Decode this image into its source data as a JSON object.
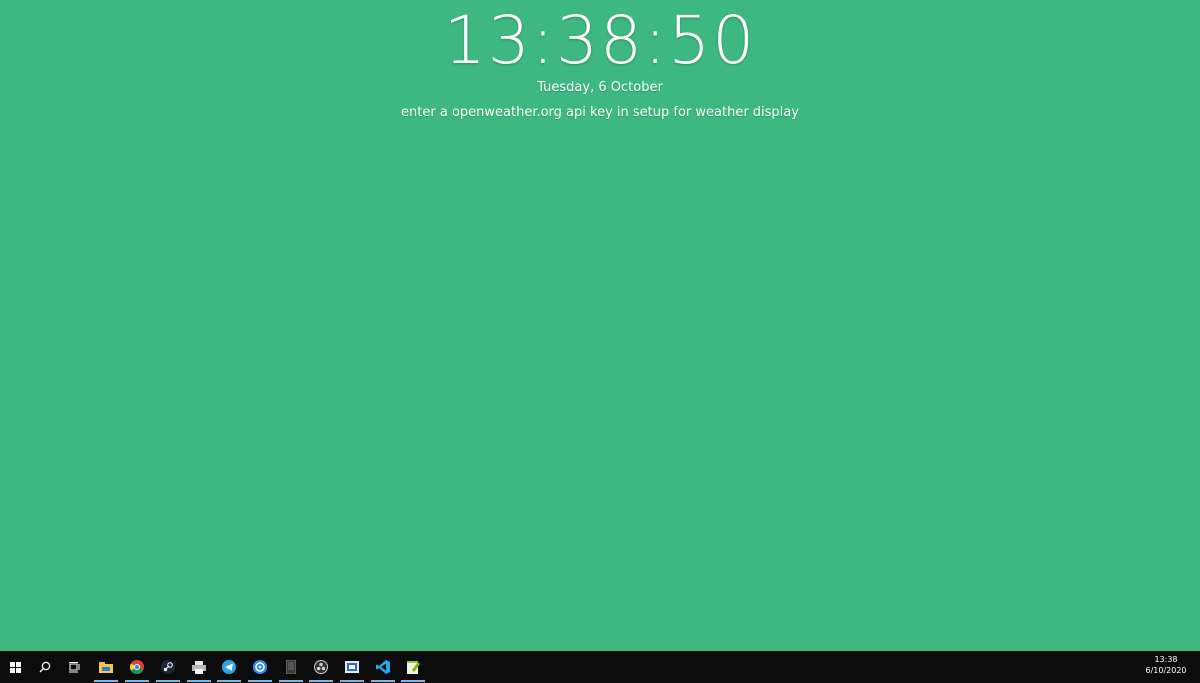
{
  "clock": {
    "time": "13:38:50",
    "date": "Tuesday, 6 October",
    "weather_message": "enter a openweather.org api key in setup for weather display"
  },
  "colors": {
    "background": "#3cb880",
    "taskbar": "#0c0c0c",
    "running_indicator": "#76b9ed",
    "text": "#ffffff"
  },
  "taskbar": {
    "system_buttons": [
      {
        "icon": "windows-start-icon"
      },
      {
        "icon": "search-icon"
      },
      {
        "icon": "task-view-icon"
      }
    ],
    "apps": [
      {
        "icon": "file-explorer-icon"
      },
      {
        "icon": "chrome-icon"
      },
      {
        "icon": "steam-icon"
      },
      {
        "icon": "printer-app-icon"
      },
      {
        "icon": "telegram-icon"
      },
      {
        "icon": "app-circle-icon"
      },
      {
        "icon": "phone-app-icon"
      },
      {
        "icon": "obs-icon"
      },
      {
        "icon": "window-app-icon"
      },
      {
        "icon": "vscode-icon"
      },
      {
        "icon": "notepad-plus-icon"
      }
    ],
    "tray_time": "13:38",
    "tray_date": "6/10/2020"
  }
}
